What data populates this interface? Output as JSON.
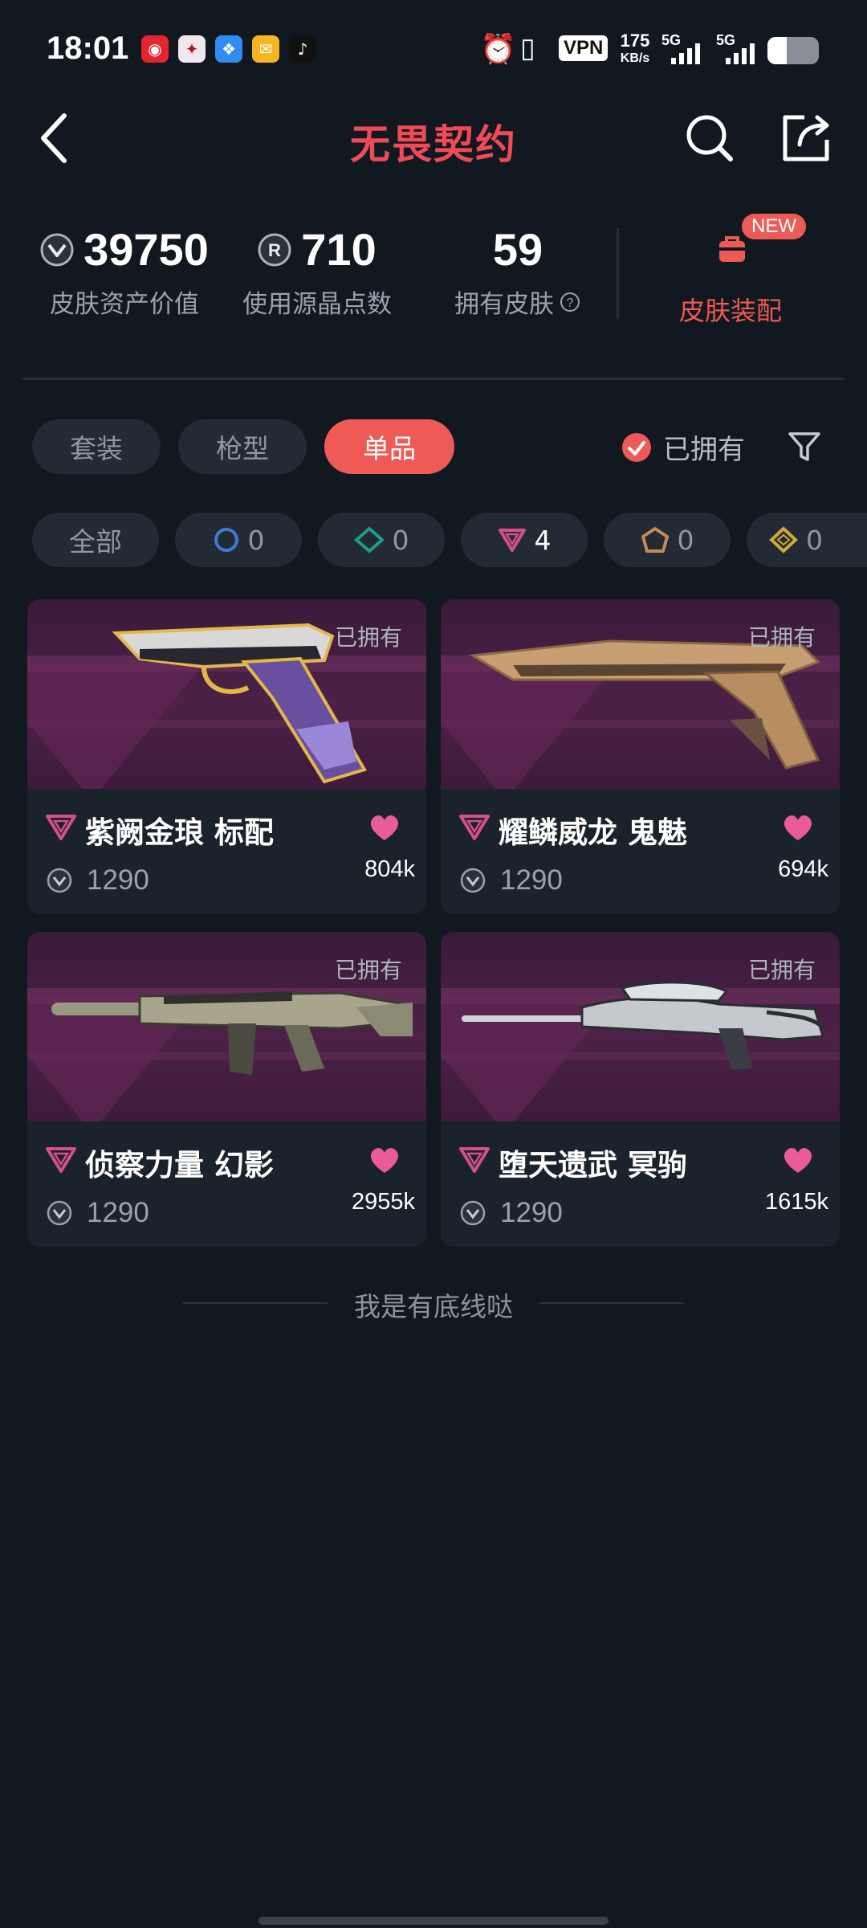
{
  "status_bar": {
    "time": "18:01",
    "net_speed": "175",
    "net_unit": "KB/s",
    "net1": "5G",
    "net2": "5G",
    "vpn": "VPN"
  },
  "header": {
    "title": "无畏契约"
  },
  "stats": [
    {
      "value": "39750",
      "label": "皮肤资产价值",
      "icon": "vp-coin-icon"
    },
    {
      "value": "710",
      "label": "使用源晶点数",
      "icon": "radianite-icon"
    },
    {
      "value": "59",
      "label": "拥有皮肤",
      "icon": "help-icon"
    }
  ],
  "loadout": {
    "label": "皮肤装配",
    "badge": "NEW"
  },
  "tabs": [
    {
      "label": "套装",
      "active": false
    },
    {
      "label": "枪型",
      "active": false
    },
    {
      "label": "单品",
      "active": true
    }
  ],
  "owned_filter": {
    "label": "已拥有",
    "checked": true
  },
  "tier_chips": [
    {
      "label": "全部"
    },
    {
      "count": "0",
      "tier": "select"
    },
    {
      "count": "0",
      "tier": "deluxe"
    },
    {
      "count": "4",
      "tier": "premium"
    },
    {
      "count": "0",
      "tier": "exclusive"
    },
    {
      "count": "0",
      "tier": "ultra"
    }
  ],
  "skins": [
    {
      "name": "紫阙金琅 标配",
      "price": "1290",
      "likes": "804k",
      "owned": "已拥有"
    },
    {
      "name": "耀鳞威龙 鬼魅",
      "price": "1290",
      "likes": "694k",
      "owned": "已拥有"
    },
    {
      "name": "侦察力量 幻影",
      "price": "1290",
      "likes": "2955k",
      "owned": "已拥有"
    },
    {
      "name": "堕天遗武 冥驹",
      "price": "1290",
      "likes": "1615k",
      "owned": "已拥有"
    }
  ],
  "footer_text": "我是有底线哒",
  "colors": {
    "accent": "#ee5a56",
    "background": "#111820",
    "card": "#1a222b",
    "heart": "#ea5b9a",
    "tier_premium": "#d44f8b"
  }
}
